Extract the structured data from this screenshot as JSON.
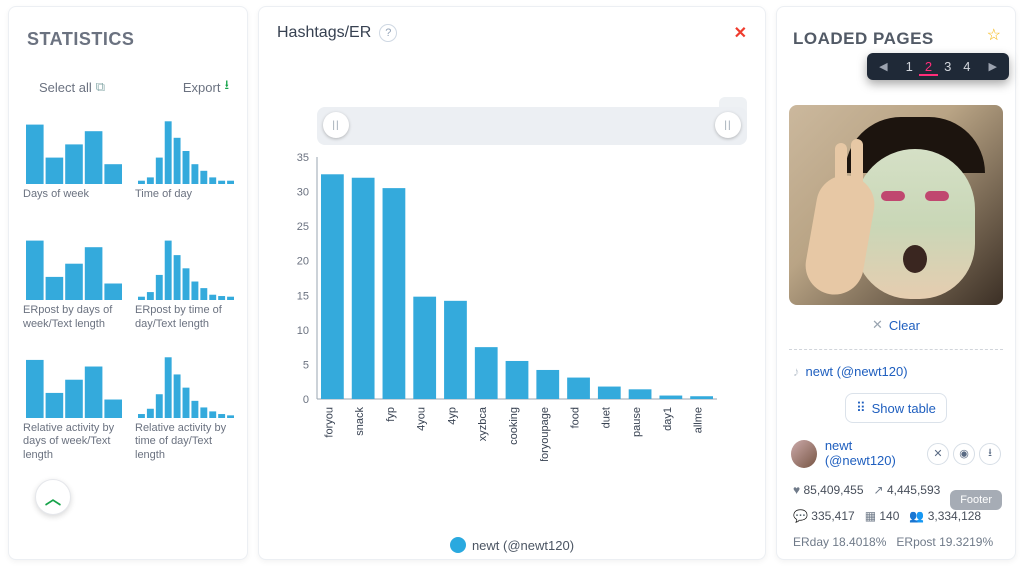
{
  "stats": {
    "title": "STATISTICS",
    "select_all": "Select all",
    "export": "Export",
    "thumbs": [
      {
        "label": "Days of week"
      },
      {
        "label": "Time of day"
      },
      {
        "label": "ERpost by days of week/Text length"
      },
      {
        "label": "ERpost by time of day/Text length"
      },
      {
        "label": "Relative activity by days of week/Text length"
      },
      {
        "label": "Relative activity by time of day/Text length"
      }
    ]
  },
  "main": {
    "title": "Hashtags/ER",
    "legend": "newt (@newt120)"
  },
  "chart_data": {
    "type": "bar",
    "title": "Hashtags/ER",
    "xlabel": "",
    "ylabel": "",
    "ylim": [
      0,
      35
    ],
    "yticks": [
      0,
      5,
      10,
      15,
      20,
      25,
      30,
      35
    ],
    "categories": [
      "foryou",
      "snack",
      "fyp",
      "4you",
      "4yp",
      "xyzbca",
      "cooking",
      "foryoupage",
      "food",
      "duet",
      "pause",
      "day1",
      "allme"
    ],
    "values": [
      32.5,
      32,
      30.5,
      14.8,
      14.2,
      7.5,
      5.5,
      4.2,
      3.1,
      1.8,
      1.4,
      0.5,
      0.4
    ],
    "series_name": "newt (@newt120)",
    "bar_color": "#34aadc"
  },
  "right": {
    "title": "LOADED PAGES",
    "pages": [
      "1",
      "2",
      "3",
      "4"
    ],
    "current_page": "2",
    "clear": "Clear",
    "handle": "newt (@newt120)",
    "show_table": "Show table",
    "account_name": "newt (@newt120)",
    "stats": {
      "hearts": "85,409,455",
      "shares": "4,445,593",
      "comments": "335,417",
      "videos": "140",
      "followers": "3,334,128",
      "erday": "ERday 18.4018%",
      "erpost": "ERpost 19.3219%"
    }
  },
  "footer_chip": "Footer"
}
